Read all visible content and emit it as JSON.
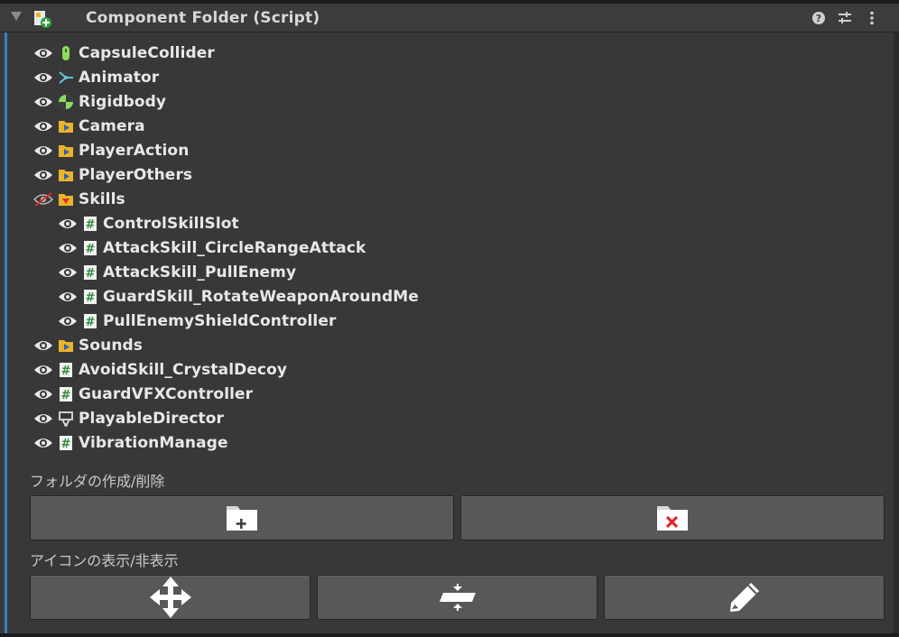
{
  "header": {
    "title": "Component Folder (Script)",
    "icons": [
      "foldout-arrow-icon",
      "script-folder-add-icon",
      "help-icon",
      "preset-sliders-icon",
      "kebab-menu-icon"
    ]
  },
  "tree": [
    {
      "label": "CapsuleCollider",
      "icon": "capsule-collider-icon",
      "visible": true,
      "indent": 0
    },
    {
      "label": "Animator",
      "icon": "animator-icon",
      "visible": true,
      "indent": 0
    },
    {
      "label": "Rigidbody",
      "icon": "rigidbody-icon",
      "visible": true,
      "indent": 0
    },
    {
      "label": "Camera",
      "icon": "folder-collapsed-icon",
      "visible": true,
      "indent": 0
    },
    {
      "label": "PlayerAction",
      "icon": "folder-collapsed-icon",
      "visible": true,
      "indent": 0
    },
    {
      "label": "PlayerOthers",
      "icon": "folder-collapsed-icon",
      "visible": true,
      "indent": 0
    },
    {
      "label": "Skills",
      "icon": "folder-expanded-icon",
      "visible": false,
      "indent": 0
    },
    {
      "label": "ControlSkillSlot",
      "icon": "script-icon",
      "visible": true,
      "indent": 1
    },
    {
      "label": "AttackSkill_CircleRangeAttack",
      "icon": "script-icon",
      "visible": true,
      "indent": 1
    },
    {
      "label": "AttackSkill_PullEnemy",
      "icon": "script-icon",
      "visible": true,
      "indent": 1
    },
    {
      "label": "GuardSkill_RotateWeaponAroundMe",
      "icon": "script-icon",
      "visible": true,
      "indent": 1
    },
    {
      "label": "PullEnemyShieldController",
      "icon": "script-icon",
      "visible": true,
      "indent": 1
    },
    {
      "label": "Sounds",
      "icon": "folder-collapsed-icon",
      "visible": true,
      "indent": 0
    },
    {
      "label": "AvoidSkill_CrystalDecoy",
      "icon": "script-icon",
      "visible": true,
      "indent": 0
    },
    {
      "label": "GuardVFXController",
      "icon": "script-icon",
      "visible": true,
      "indent": 0
    },
    {
      "label": "PlayableDirector",
      "icon": "playable-director-icon",
      "visible": true,
      "indent": 0
    },
    {
      "label": "VibrationManage",
      "icon": "script-icon",
      "visible": true,
      "indent": 0
    }
  ],
  "folder_section": {
    "label": "フォルダの作成/削除",
    "buttons": [
      "folder-add-icon",
      "folder-delete-icon"
    ]
  },
  "icon_section": {
    "label": "アイコンの表示/非表示",
    "buttons": [
      "move-arrows-icon",
      "collapse-expand-icon",
      "pencil-edit-icon"
    ]
  },
  "colors": {
    "background": "#383838",
    "button": "#585858",
    "accent_bar": "#3a7fc4",
    "folder": "#e8b52a",
    "script": "#4caf50",
    "delete": "#e02a2a"
  }
}
